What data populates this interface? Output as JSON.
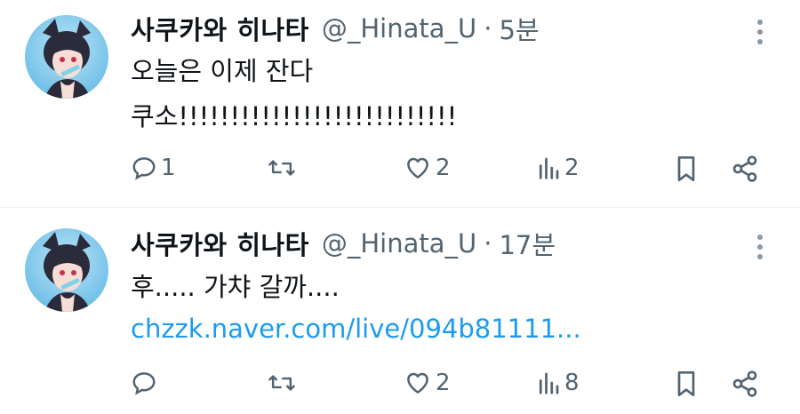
{
  "tweets": [
    {
      "author_name": "사쿠카와 히나타",
      "handle": "@_Hinata_U",
      "separator": "·",
      "time": "5분",
      "lines": [
        "오늘은 이제 잔다",
        "쿠소!!!!!!!!!!!!!!!!!!!!!!!!!!!"
      ],
      "replies": "1",
      "retweets": "",
      "likes": "2",
      "views": "2"
    },
    {
      "author_name": "사쿠카와 히나타",
      "handle": "@_Hinata_U",
      "separator": "·",
      "time": "17분",
      "lines": [
        "후..... 가챠 갈까....",
        "chzzk.naver.com/live/094b81111..."
      ],
      "replies": "",
      "retweets": "",
      "likes": "2",
      "views": "8"
    }
  ],
  "icons": {
    "more": "more-vertical-icon",
    "reply": "reply-icon",
    "retweet": "retweet-icon",
    "like": "heart-icon",
    "views": "views-icon",
    "bookmark": "bookmark-icon",
    "share": "share-icon"
  },
  "colors": {
    "text": "#0f1419",
    "secondary": "#536471",
    "link": "#1d9bf0",
    "divider": "#eff3f4"
  }
}
